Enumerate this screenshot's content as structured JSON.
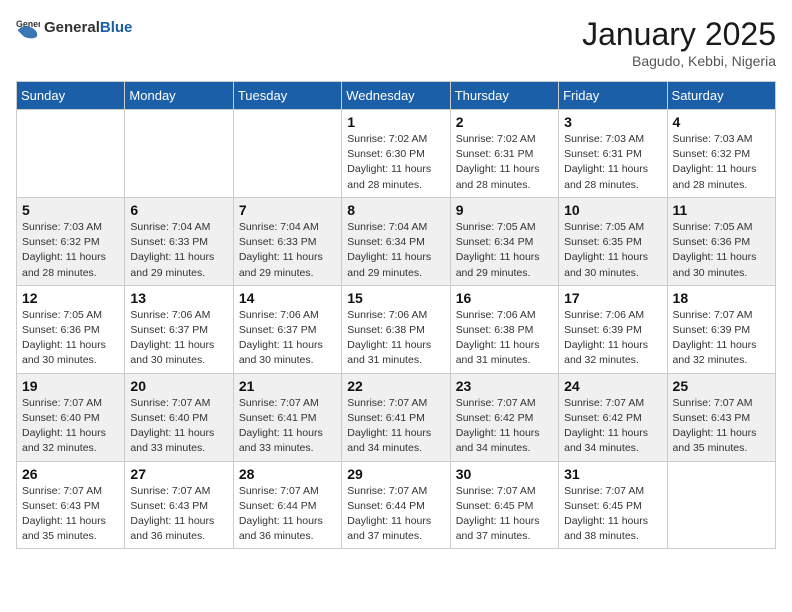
{
  "header": {
    "logo_general": "General",
    "logo_blue": "Blue",
    "month": "January 2025",
    "location": "Bagudo, Kebbi, Nigeria"
  },
  "days_of_week": [
    "Sunday",
    "Monday",
    "Tuesday",
    "Wednesday",
    "Thursday",
    "Friday",
    "Saturday"
  ],
  "weeks": [
    {
      "shaded": false,
      "cells": [
        {
          "day": "",
          "sunrise": "",
          "sunset": "",
          "daylight": ""
        },
        {
          "day": "",
          "sunrise": "",
          "sunset": "",
          "daylight": ""
        },
        {
          "day": "",
          "sunrise": "",
          "sunset": "",
          "daylight": ""
        },
        {
          "day": "1",
          "sunrise": "Sunrise: 7:02 AM",
          "sunset": "Sunset: 6:30 PM",
          "daylight": "Daylight: 11 hours and 28 minutes."
        },
        {
          "day": "2",
          "sunrise": "Sunrise: 7:02 AM",
          "sunset": "Sunset: 6:31 PM",
          "daylight": "Daylight: 11 hours and 28 minutes."
        },
        {
          "day": "3",
          "sunrise": "Sunrise: 7:03 AM",
          "sunset": "Sunset: 6:31 PM",
          "daylight": "Daylight: 11 hours and 28 minutes."
        },
        {
          "day": "4",
          "sunrise": "Sunrise: 7:03 AM",
          "sunset": "Sunset: 6:32 PM",
          "daylight": "Daylight: 11 hours and 28 minutes."
        }
      ]
    },
    {
      "shaded": true,
      "cells": [
        {
          "day": "5",
          "sunrise": "Sunrise: 7:03 AM",
          "sunset": "Sunset: 6:32 PM",
          "daylight": "Daylight: 11 hours and 28 minutes."
        },
        {
          "day": "6",
          "sunrise": "Sunrise: 7:04 AM",
          "sunset": "Sunset: 6:33 PM",
          "daylight": "Daylight: 11 hours and 29 minutes."
        },
        {
          "day": "7",
          "sunrise": "Sunrise: 7:04 AM",
          "sunset": "Sunset: 6:33 PM",
          "daylight": "Daylight: 11 hours and 29 minutes."
        },
        {
          "day": "8",
          "sunrise": "Sunrise: 7:04 AM",
          "sunset": "Sunset: 6:34 PM",
          "daylight": "Daylight: 11 hours and 29 minutes."
        },
        {
          "day": "9",
          "sunrise": "Sunrise: 7:05 AM",
          "sunset": "Sunset: 6:34 PM",
          "daylight": "Daylight: 11 hours and 29 minutes."
        },
        {
          "day": "10",
          "sunrise": "Sunrise: 7:05 AM",
          "sunset": "Sunset: 6:35 PM",
          "daylight": "Daylight: 11 hours and 30 minutes."
        },
        {
          "day": "11",
          "sunrise": "Sunrise: 7:05 AM",
          "sunset": "Sunset: 6:36 PM",
          "daylight": "Daylight: 11 hours and 30 minutes."
        }
      ]
    },
    {
      "shaded": false,
      "cells": [
        {
          "day": "12",
          "sunrise": "Sunrise: 7:05 AM",
          "sunset": "Sunset: 6:36 PM",
          "daylight": "Daylight: 11 hours and 30 minutes."
        },
        {
          "day": "13",
          "sunrise": "Sunrise: 7:06 AM",
          "sunset": "Sunset: 6:37 PM",
          "daylight": "Daylight: 11 hours and 30 minutes."
        },
        {
          "day": "14",
          "sunrise": "Sunrise: 7:06 AM",
          "sunset": "Sunset: 6:37 PM",
          "daylight": "Daylight: 11 hours and 30 minutes."
        },
        {
          "day": "15",
          "sunrise": "Sunrise: 7:06 AM",
          "sunset": "Sunset: 6:38 PM",
          "daylight": "Daylight: 11 hours and 31 minutes."
        },
        {
          "day": "16",
          "sunrise": "Sunrise: 7:06 AM",
          "sunset": "Sunset: 6:38 PM",
          "daylight": "Daylight: 11 hours and 31 minutes."
        },
        {
          "day": "17",
          "sunrise": "Sunrise: 7:06 AM",
          "sunset": "Sunset: 6:39 PM",
          "daylight": "Daylight: 11 hours and 32 minutes."
        },
        {
          "day": "18",
          "sunrise": "Sunrise: 7:07 AM",
          "sunset": "Sunset: 6:39 PM",
          "daylight": "Daylight: 11 hours and 32 minutes."
        }
      ]
    },
    {
      "shaded": true,
      "cells": [
        {
          "day": "19",
          "sunrise": "Sunrise: 7:07 AM",
          "sunset": "Sunset: 6:40 PM",
          "daylight": "Daylight: 11 hours and 32 minutes."
        },
        {
          "day": "20",
          "sunrise": "Sunrise: 7:07 AM",
          "sunset": "Sunset: 6:40 PM",
          "daylight": "Daylight: 11 hours and 33 minutes."
        },
        {
          "day": "21",
          "sunrise": "Sunrise: 7:07 AM",
          "sunset": "Sunset: 6:41 PM",
          "daylight": "Daylight: 11 hours and 33 minutes."
        },
        {
          "day": "22",
          "sunrise": "Sunrise: 7:07 AM",
          "sunset": "Sunset: 6:41 PM",
          "daylight": "Daylight: 11 hours and 34 minutes."
        },
        {
          "day": "23",
          "sunrise": "Sunrise: 7:07 AM",
          "sunset": "Sunset: 6:42 PM",
          "daylight": "Daylight: 11 hours and 34 minutes."
        },
        {
          "day": "24",
          "sunrise": "Sunrise: 7:07 AM",
          "sunset": "Sunset: 6:42 PM",
          "daylight": "Daylight: 11 hours and 34 minutes."
        },
        {
          "day": "25",
          "sunrise": "Sunrise: 7:07 AM",
          "sunset": "Sunset: 6:43 PM",
          "daylight": "Daylight: 11 hours and 35 minutes."
        }
      ]
    },
    {
      "shaded": false,
      "cells": [
        {
          "day": "26",
          "sunrise": "Sunrise: 7:07 AM",
          "sunset": "Sunset: 6:43 PM",
          "daylight": "Daylight: 11 hours and 35 minutes."
        },
        {
          "day": "27",
          "sunrise": "Sunrise: 7:07 AM",
          "sunset": "Sunset: 6:43 PM",
          "daylight": "Daylight: 11 hours and 36 minutes."
        },
        {
          "day": "28",
          "sunrise": "Sunrise: 7:07 AM",
          "sunset": "Sunset: 6:44 PM",
          "daylight": "Daylight: 11 hours and 36 minutes."
        },
        {
          "day": "29",
          "sunrise": "Sunrise: 7:07 AM",
          "sunset": "Sunset: 6:44 PM",
          "daylight": "Daylight: 11 hours and 37 minutes."
        },
        {
          "day": "30",
          "sunrise": "Sunrise: 7:07 AM",
          "sunset": "Sunset: 6:45 PM",
          "daylight": "Daylight: 11 hours and 37 minutes."
        },
        {
          "day": "31",
          "sunrise": "Sunrise: 7:07 AM",
          "sunset": "Sunset: 6:45 PM",
          "daylight": "Daylight: 11 hours and 38 minutes."
        },
        {
          "day": "",
          "sunrise": "",
          "sunset": "",
          "daylight": ""
        }
      ]
    }
  ]
}
